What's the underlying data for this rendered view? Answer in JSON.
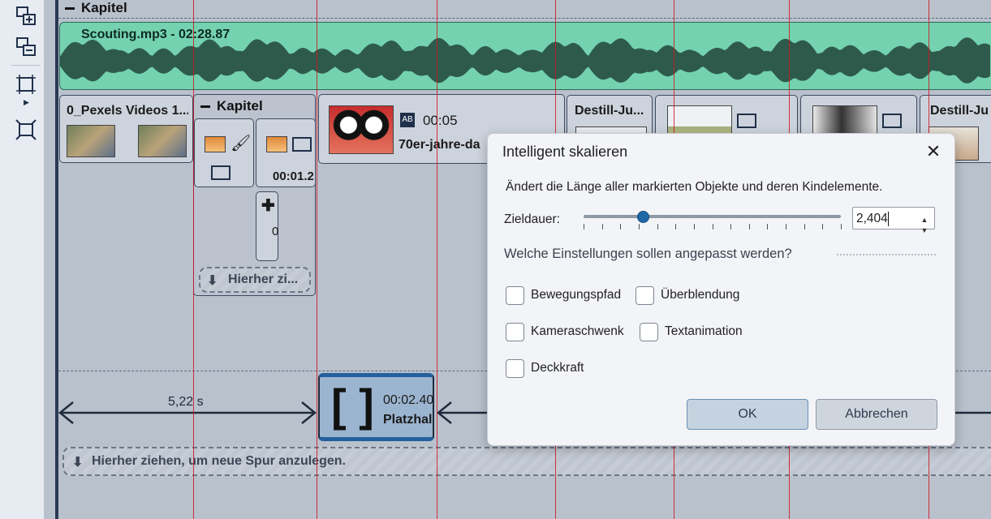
{
  "left_toolbar": {
    "tools": [
      "group-add-icon",
      "group-remove-icon",
      "fit-icon",
      "scale-icon"
    ]
  },
  "timeline": {
    "chapter_top": "Kapitel",
    "audio": {
      "title": "Scouting.mp3 - 02:28.87"
    },
    "clips": [
      {
        "title": "0_Pexels Videos 1..."
      },
      {
        "title": "Kapitel"
      },
      {
        "duration": "00:05",
        "title": "70er-jahre-da"
      },
      {
        "title": "Destill-Ju..."
      },
      {
        "title": "Destill-Ju"
      }
    ],
    "sub_clip_duration": "00:01.2",
    "sub_clip_partial": "0",
    "inner_drop": "Hierher zi...",
    "gap_label": "5,22 s",
    "placeholder": {
      "duration": "00:02.40",
      "title": "Platzhal"
    },
    "drop_hint": "Hierher ziehen, um neue Spur anzulegen.",
    "colors": {
      "audio": "#74d2b0",
      "marker": "#d0161f",
      "placeholder": "#9bb4cf"
    }
  },
  "dialog": {
    "title": "Intelligent skalieren",
    "description": "Ändert die Länge aller markierten Objekte und deren Kindelemente.",
    "duration_label": "Zieldauer:",
    "duration_value": "2,404",
    "slider_value": 0.23,
    "question": "Welche Einstellungen sollen angepasst werden?",
    "options": [
      {
        "label": "Bewegungspfad",
        "checked": false
      },
      {
        "label": "Überblendung",
        "checked": false
      },
      {
        "label": "Kameraschwenk",
        "checked": false
      },
      {
        "label": "Textanimation",
        "checked": false
      },
      {
        "label": "Deckkraft",
        "checked": false
      }
    ],
    "ok_label": "OK",
    "cancel_label": "Abbrechen"
  }
}
